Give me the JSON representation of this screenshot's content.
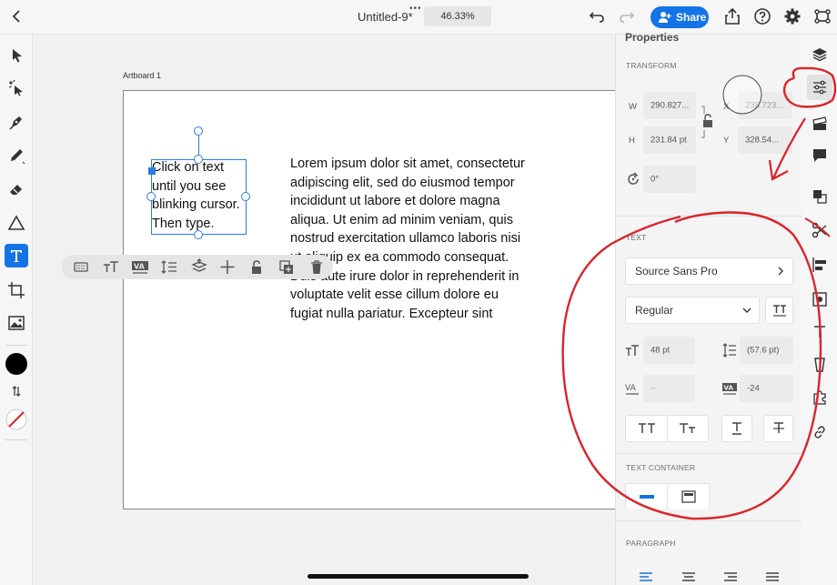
{
  "header": {
    "document_title": "Untitled-9*",
    "zoom": "46.33%",
    "share_label": "Share"
  },
  "left_toolbar": {
    "tools": [
      "select-tool",
      "direct-select-tool",
      "pen-tool",
      "pencil-tool",
      "eraser-tool",
      "shape-tool",
      "text-tool",
      "crop-tool",
      "image-tool"
    ],
    "active_tool": "text-tool",
    "fill_color": "#000000",
    "stroke_color": "#d9252b"
  },
  "canvas": {
    "artboard_label": "Artboard 1",
    "selected_text": "Click on text until you see blinking cursor. Then type.",
    "body_text": "Lorem ipsum dolor sit amet, consectetur adipiscing elit, sed do eiusmod tempor incididunt ut labore et dolore magna aliqua. Ut enim ad minim veniam, quis nostrud exercitation ullamco laboris nisi ut aliquip ex ea commodo consequat. Duis aute irure dolor in reprehenderit in voluptate velit esse cillum dolore eu fugiat nulla pariatur. Excepteur sint"
  },
  "properties": {
    "title": "Properties",
    "transform": {
      "section_label": "TRANSFORM",
      "w_label": "W",
      "w_value": "290.827...",
      "h_label": "H",
      "h_value": "231.84 pt",
      "x_label": "X",
      "x_value": "235.723...",
      "y_label": "Y",
      "y_value": "328.54...",
      "rotation_value": "0°"
    },
    "text": {
      "section_label": "TEXT",
      "font_family": "Source Sans Pro",
      "font_style": "Regular",
      "font_size": "48 pt",
      "leading": "(57.6 pt)",
      "kerning": "--",
      "tracking": "-24"
    },
    "text_container": {
      "section_label": "TEXT CONTAINER"
    },
    "paragraph": {
      "section_label": "PARAGRAPH"
    }
  },
  "colors": {
    "accent": "#1473e6",
    "annotation_red": "#d9252b",
    "selection_blue": "#2d7be5"
  }
}
